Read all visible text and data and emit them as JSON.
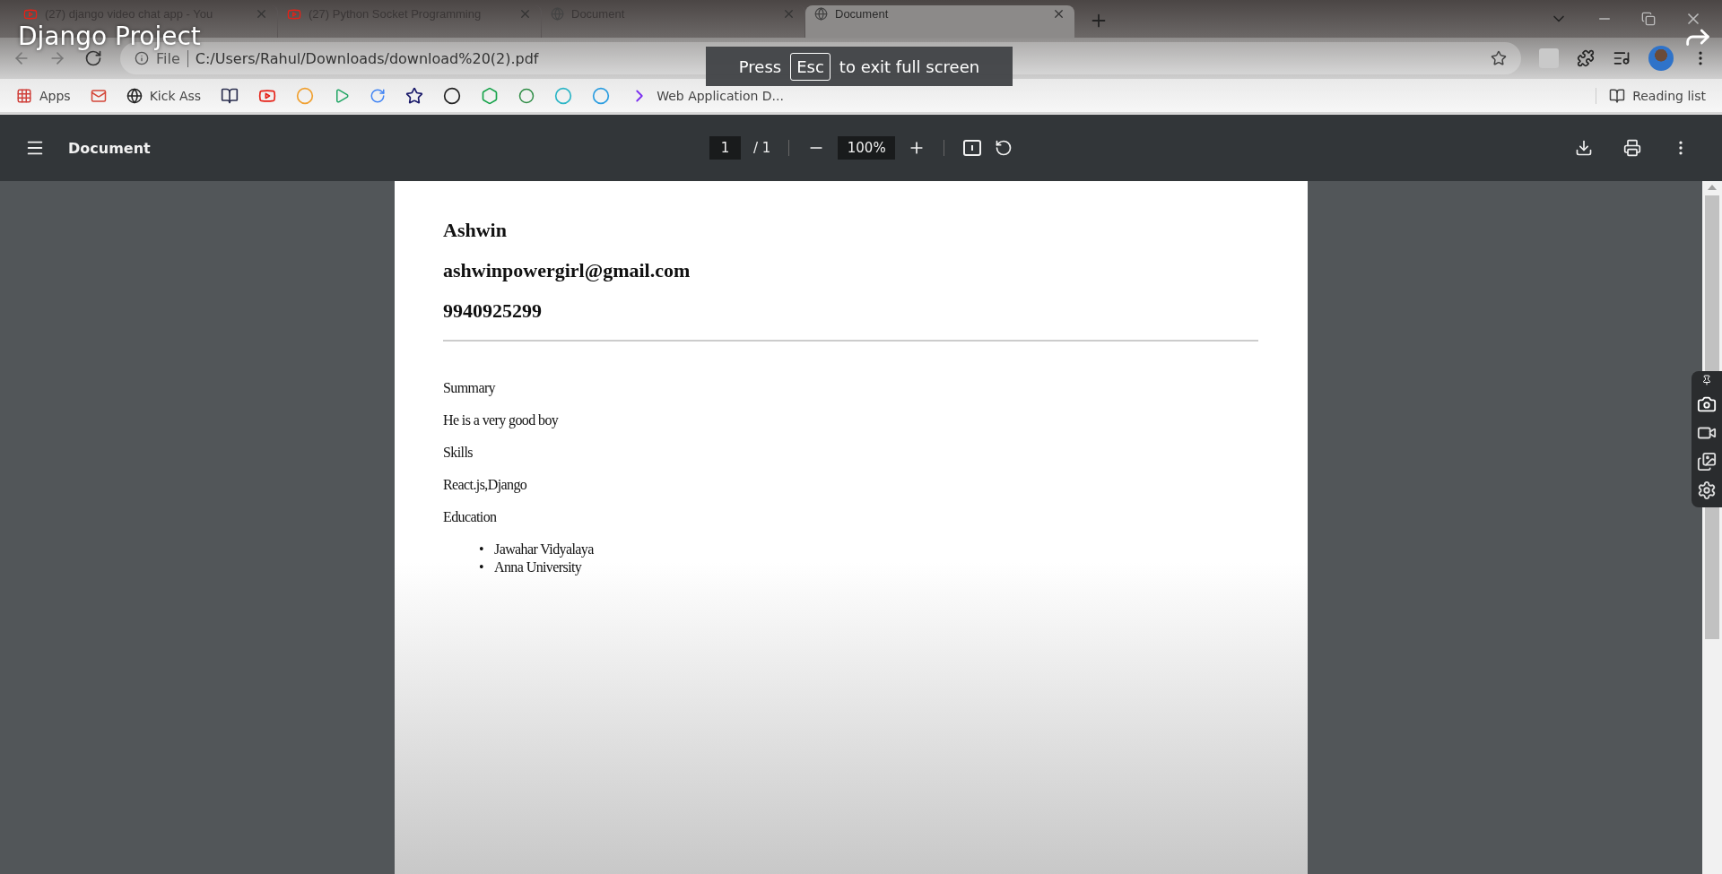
{
  "video": {
    "title": "Django Project"
  },
  "tabs": [
    {
      "title": "(27) django video chat app - You",
      "kind": "video",
      "selected": false
    },
    {
      "title": "(27) Python Socket Programming",
      "kind": "video",
      "selected": false
    },
    {
      "title": "Document",
      "kind": "page",
      "selected": false
    },
    {
      "title": "Document",
      "kind": "page",
      "selected": true
    }
  ],
  "address_bar": {
    "scheme": "File",
    "url": "C:/Users/Rahul/Downloads/download%20(2).pdf"
  },
  "bookmarks": [
    {
      "kind": "labeled",
      "label": "Apps"
    },
    {
      "kind": "icon"
    },
    {
      "kind": "labeled",
      "label": "Kick Ass"
    },
    {
      "kind": "icon"
    },
    {
      "kind": "icon"
    },
    {
      "kind": "icon"
    },
    {
      "kind": "icon"
    },
    {
      "kind": "icon"
    },
    {
      "kind": "icon"
    },
    {
      "kind": "icon"
    },
    {
      "kind": "icon"
    },
    {
      "kind": "icon"
    },
    {
      "kind": "icon"
    },
    {
      "kind": "icon"
    },
    {
      "kind": "labeled",
      "label": "Web Application D..."
    }
  ],
  "reading_list": "Reading list",
  "fullscreen_toast": {
    "before": "Press",
    "key": "Esc",
    "after": "to exit full screen"
  },
  "pdf_viewer": {
    "title": "Document",
    "page": "1",
    "separator": "/",
    "pages": "1",
    "zoom": "100%"
  },
  "document": {
    "headings": [
      "Ashwin",
      "ashwinpowergirl@gmail.com",
      "9940925299"
    ],
    "paragraphs": [
      "Summary",
      "He is a very good boy",
      "Skills",
      "React.js,Django",
      "Education"
    ],
    "bullet": "•",
    "list": [
      "Jawahar Vidyalaya",
      "Anna University"
    ]
  }
}
